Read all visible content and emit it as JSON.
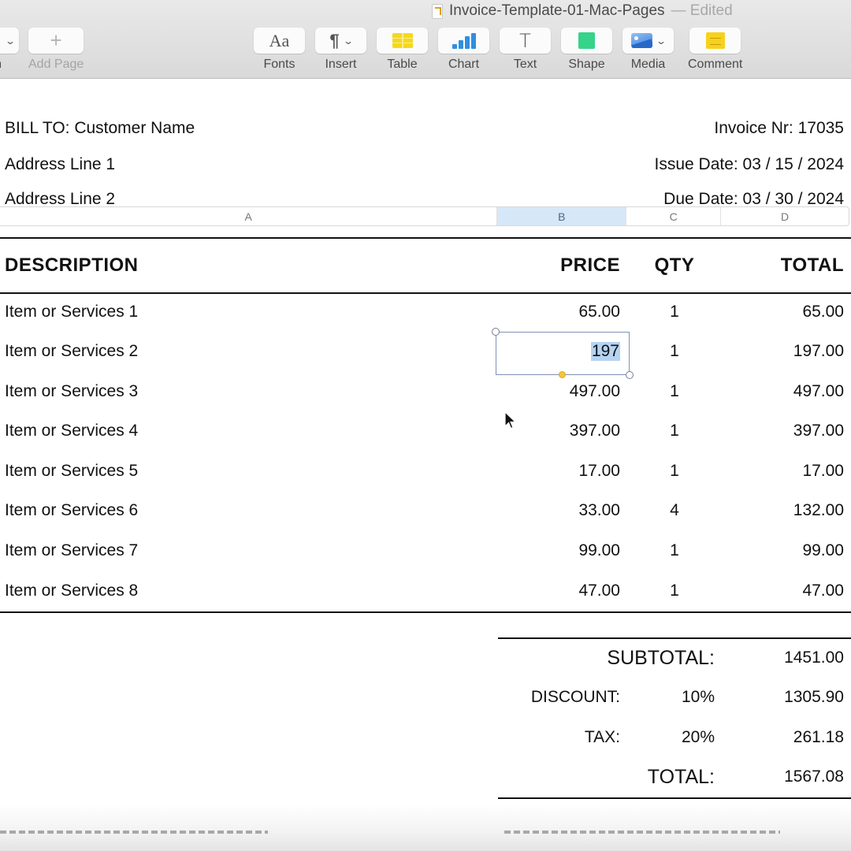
{
  "window": {
    "title": "Invoice-Template-01-Mac-Pages",
    "status": "— Edited"
  },
  "toolbar": {
    "items": [
      {
        "label": "n",
        "icon": "view-menu-icon"
      },
      {
        "label": "Add Page",
        "icon": "plus-icon",
        "disabled": true
      },
      {
        "label": "Fonts",
        "icon": "fonts-icon"
      },
      {
        "label": "Insert",
        "icon": "paragraph-icon"
      },
      {
        "label": "Table",
        "icon": "table-icon"
      },
      {
        "label": "Chart",
        "icon": "chart-icon"
      },
      {
        "label": "Text",
        "icon": "text-icon"
      },
      {
        "label": "Shape",
        "icon": "shape-icon"
      },
      {
        "label": "Media",
        "icon": "media-icon"
      },
      {
        "label": "Comment",
        "icon": "comment-icon"
      }
    ],
    "glyphs": {
      "fonts": "Aa",
      "insert": "¶",
      "add_page": "+",
      "text": "T",
      "chevron": "⌄"
    }
  },
  "bill_to": {
    "customer": "BILL TO: Customer Name",
    "address1": "Address Line 1",
    "address2": "Address Line 2"
  },
  "invoice_meta": {
    "number": "Invoice Nr: 17035",
    "issue_date": "Issue Date: 03 / 15 / 2024",
    "due_date": "Due Date: 03 / 30 / 2024"
  },
  "column_letters": [
    "A",
    "B",
    "C",
    "D"
  ],
  "selected_column": "B",
  "table": {
    "headers": {
      "description": "DESCRIPTION",
      "price": "PRICE",
      "qty": "QTY",
      "total": "TOTAL"
    },
    "rows": [
      {
        "description": "Item or Services 1",
        "price": "65.00",
        "qty": "1",
        "total": "65.00"
      },
      {
        "description": "Item or Services 2",
        "price": "197",
        "qty": "1",
        "total": "197.00",
        "editing": true
      },
      {
        "description": "Item or Services 3",
        "price": "497.00",
        "qty": "1",
        "total": "497.00"
      },
      {
        "description": "Item or Services 4",
        "price": "397.00",
        "qty": "1",
        "total": "397.00"
      },
      {
        "description": "Item or Services 5",
        "price": "17.00",
        "qty": "1",
        "total": "17.00"
      },
      {
        "description": "Item or Services 6",
        "price": "33.00",
        "qty": "4",
        "total": "132.00"
      },
      {
        "description": "Item or Services 7",
        "price": "99.00",
        "qty": "1",
        "total": "99.00"
      },
      {
        "description": "Item or Services 8",
        "price": "47.00",
        "qty": "1",
        "total": "47.00"
      }
    ]
  },
  "summary": {
    "subtotal_label": "SUBTOTAL:",
    "subtotal_value": "1451.00",
    "discount_label": "DISCOUNT:",
    "discount_rate": "10%",
    "discount_value": "1305.90",
    "tax_label": "TAX:",
    "tax_rate": "20%",
    "tax_value": "261.18",
    "total_label": "TOTAL:",
    "total_value": "1567.08"
  }
}
